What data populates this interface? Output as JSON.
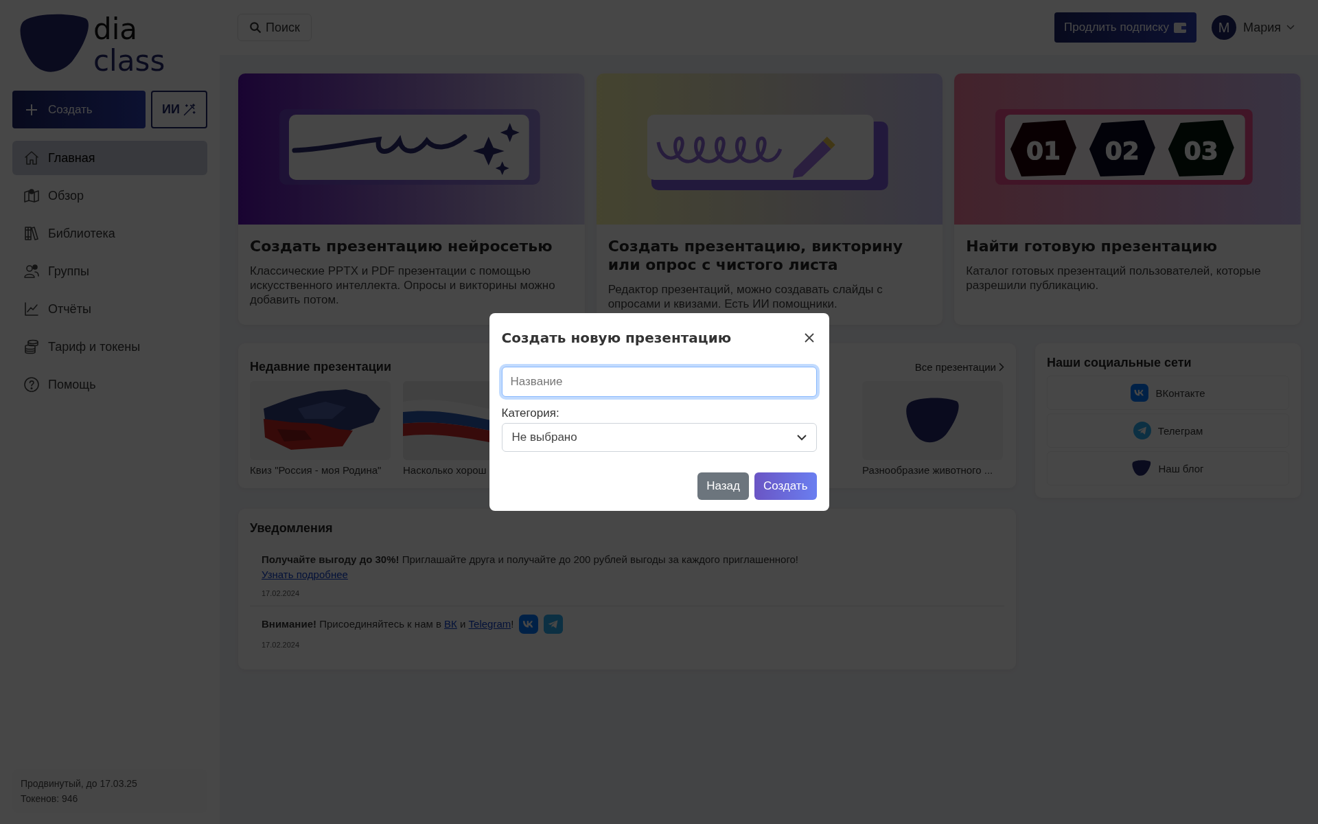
{
  "logo": {
    "line1": "dia",
    "line2": "class"
  },
  "sidebar": {
    "create_button": "Создать",
    "ai_button": "ИИ",
    "items": [
      {
        "label": "Главная",
        "selected": true
      },
      {
        "label": "Обзор",
        "selected": false
      },
      {
        "label": "Библиотека",
        "selected": false
      },
      {
        "label": "Группы",
        "selected": false
      },
      {
        "label": "Отчёты",
        "selected": false
      },
      {
        "label": "Тариф и токены",
        "selected": false
      },
      {
        "label": "Помощь",
        "selected": false
      }
    ],
    "footer": {
      "plan": "Продвинутый, до 17.03.25",
      "tokens": "Токенов: 946"
    }
  },
  "topbar": {
    "search": "Поиск",
    "subscribe_button": "Продлить подписку",
    "user": {
      "initial": "М",
      "name": "Мария"
    }
  },
  "feature_cards": [
    {
      "kind": "ai",
      "title": "Создать презентацию нейросетью",
      "description": "Классические PPTX и PDF презентации с помощью искусственного интеллекта. Опросы и викторины можно добавить потом."
    },
    {
      "kind": "blank",
      "title": "Создать презентацию, викторину или опрос с чистого листа",
      "description": "Редактор презентаций, можно создавать слайды с опросами и квизами. Есть ИИ помощники."
    },
    {
      "kind": "catalog",
      "title": "Найти готовую презентацию",
      "description": "Каталог готовых презентаций пользователей, которые разрешили публикацию.",
      "badges": [
        "01",
        "02",
        "03"
      ]
    }
  ],
  "recent": {
    "title": "Недавние презентации",
    "all_link": "Все презентации",
    "items": [
      {
        "kind": "map",
        "title": "Квиз \"Россия - моя Родина\""
      },
      {
        "kind": "flag",
        "title": "Насколько хорош"
      },
      {
        "kind": "logo",
        "title": "Разнообразие животного ..."
      }
    ]
  },
  "social": {
    "title": "Наши социальные сети",
    "links": [
      {
        "kind": "vk",
        "label": "ВКонтакте"
      },
      {
        "kind": "telegram",
        "label": "Телеграм"
      },
      {
        "kind": "blog",
        "label": "Наш блог"
      }
    ]
  },
  "notifications": {
    "title": "Уведомления",
    "items": [
      {
        "parts": [
          {
            "kind": "bold",
            "text": "Получайте выгоду до 30%!"
          },
          {
            "kind": "text",
            "text": " Приглашайте друга и получайте до 200 рублей выгоды за каждого приглашенного! "
          },
          {
            "kind": "link",
            "text": "Узнать подробнее"
          }
        ],
        "date": "17.02.2024"
      },
      {
        "parts": [
          {
            "kind": "bold",
            "text": "Внимание!"
          },
          {
            "kind": "text",
            "text": " Присоединяйтесь к нам в "
          },
          {
            "kind": "link",
            "text": "ВК"
          },
          {
            "kind": "text",
            "text": " и "
          },
          {
            "kind": "link",
            "text": "Telegram"
          },
          {
            "kind": "text",
            "text": "!"
          }
        ],
        "date": "17.02.2024",
        "badges": [
          {
            "kind": "vk"
          },
          {
            "kind": "telegram"
          }
        ]
      }
    ]
  },
  "modal": {
    "title": "Создать новую презентацию",
    "name_placeholder": "Название",
    "category_label": "Категория:",
    "category_value": "Не выбрано",
    "back_button": "Назад",
    "create_button": "Создать"
  }
}
